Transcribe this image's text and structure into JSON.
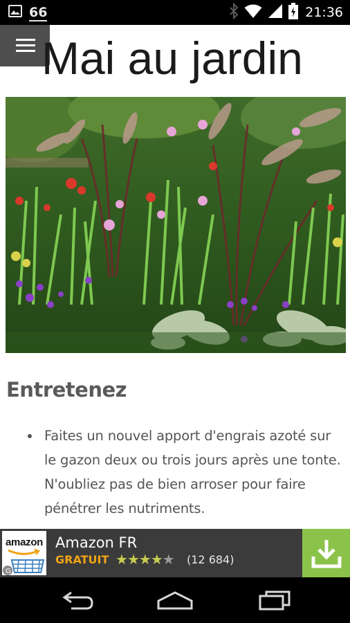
{
  "status_bar": {
    "notification_count": "66",
    "time": "21:36",
    "icons": [
      "image-notification-icon",
      "bluetooth-icon",
      "wifi-icon",
      "signal-icon",
      "battery-icon"
    ]
  },
  "header": {
    "menu_icon": "hamburger-menu-icon",
    "title": "Mai au jardin"
  },
  "article": {
    "hero_image": "garden-flowerbed-photo",
    "section_heading": "Entretenez",
    "bullets": [
      "Faites un nouvel apport d'engrais azoté sur le gazon deux ou trois jours après une tonte. N'oubliez pas de bien arroser pour faire pénétrer les nutriments."
    ]
  },
  "ad": {
    "logo_text": "amazon",
    "app_name": "Amazon FR",
    "price_label": "GRATUIT",
    "rating": 4,
    "rating_max": 5,
    "reviews": "(12 684)",
    "install_icon": "download-icon"
  },
  "navigation": {
    "buttons": [
      "back-icon",
      "home-icon",
      "recent-apps-icon"
    ]
  },
  "colors": {
    "status_bar": "#000000",
    "menu_button": "#4e4e4e",
    "ad_background": "#3b3b3b",
    "ad_install": "#8bc34a",
    "price_label": "#f0a316",
    "star_on": "#c8cc52",
    "text_body": "#555555"
  }
}
